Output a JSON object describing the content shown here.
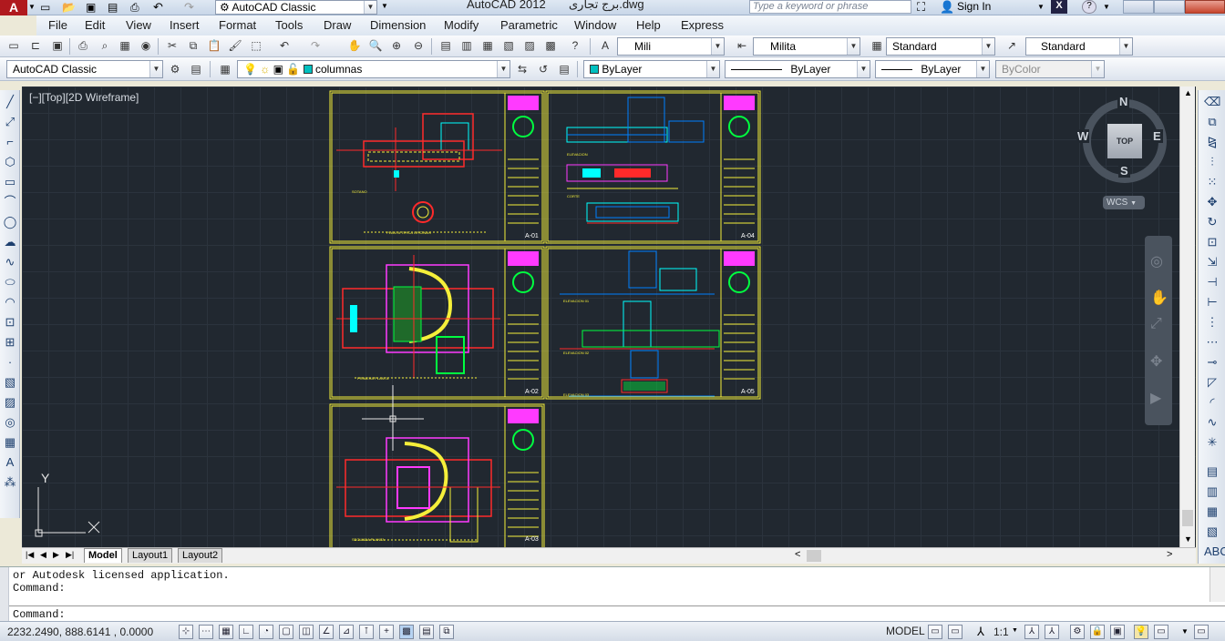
{
  "window": {
    "title": "AutoCAD 2012",
    "document": "برج تجاری.dwg",
    "workspace": "AutoCAD Classic",
    "search_placeholder": "Type a keyword or phrase",
    "sign_in": "Sign In"
  },
  "menu": [
    "File",
    "Edit",
    "View",
    "Insert",
    "Format",
    "Tools",
    "Draw",
    "Dimension",
    "Modify",
    "Parametric",
    "Window",
    "Help",
    "Express"
  ],
  "styles": {
    "text_style": "Mili",
    "dim_style": "Milita",
    "table_style": "Standard",
    "mleader_style": "Standard"
  },
  "layers": {
    "workspace_combo": "AutoCAD Classic",
    "current_layer": "columnas",
    "color": "ByLayer",
    "linetype": "ByLayer",
    "lineweight": "ByLayer",
    "plotstyle": "ByColor"
  },
  "viewport": {
    "label": "[−][Top][2D Wireframe]",
    "ucs_y": "Y",
    "ucs_x": "X"
  },
  "viewcube": {
    "north": "N",
    "south": "S",
    "east": "E",
    "west": "W",
    "top": "TOP",
    "wcs": "WCS"
  },
  "sheets": {
    "codes": [
      "A-01",
      "A-04",
      "A-02",
      "A-05",
      "A-03"
    ],
    "labels": [
      "PLANTA TIPICA OFICINAS",
      "SOTANO",
      "ELEVACION",
      "CORTE",
      "PRIMERA PLANTA",
      "ELEVACION 01",
      "ELEVACION 02",
      "ELEVACION 03",
      "SEGUNDA PLANTA"
    ]
  },
  "tabs": [
    "Model",
    "Layout1",
    "Layout2"
  ],
  "command": {
    "history": [
      "or Autodesk licensed application.",
      "Command:"
    ],
    "prompt": "Command:"
  },
  "status": {
    "coordinates": "2232.2490, 888.6141 , 0.0000",
    "space": "MODEL",
    "scale": "1:1"
  },
  "colors": {
    "canvas": "#212830",
    "sheet_border": "#f5ef3a",
    "title_block_accent": "#ff3aff"
  }
}
